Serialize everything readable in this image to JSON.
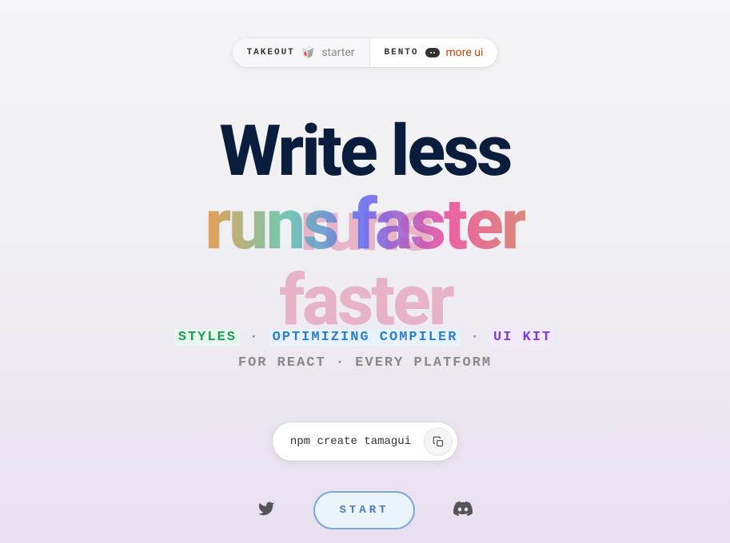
{
  "pills": {
    "takeout": {
      "title": "TAKEOUT",
      "sub": "starter",
      "emoji": "🥡"
    },
    "bento": {
      "title": "BENTO",
      "sub": "more ui"
    }
  },
  "hero": {
    "line1": "Write less",
    "line2": "runs faster"
  },
  "tagline": {
    "styles": "STYLES",
    "dot": " · ",
    "compiler": "OPTIMIZING COMPILER",
    "uikit": "UI KIT",
    "sub": "FOR REACT · EVERY PLATFORM"
  },
  "command": "npm create tamagui",
  "start": "START"
}
